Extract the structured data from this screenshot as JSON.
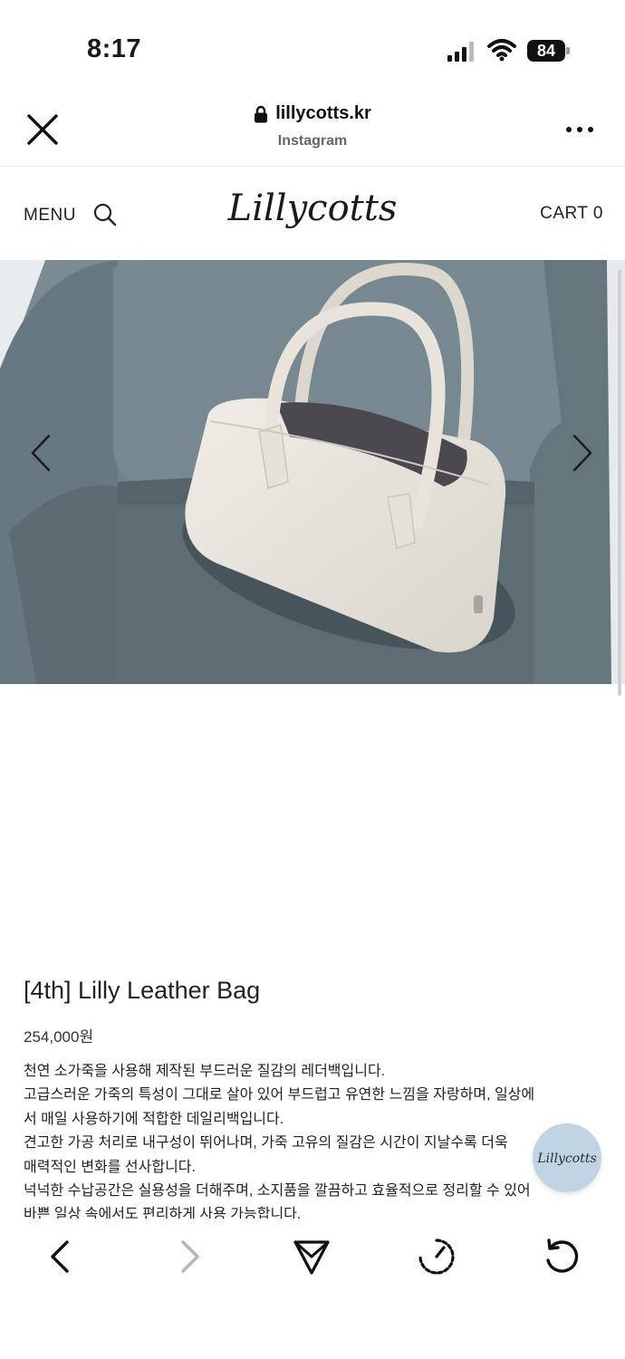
{
  "status_bar": {
    "time": "8:17",
    "battery": "84"
  },
  "browser": {
    "url": "lillycotts.kr",
    "source": "Instagram"
  },
  "site_header": {
    "menu_label": "MENU",
    "logo_text": "Lillycotts",
    "cart_label": "CART 0"
  },
  "product": {
    "title": "[4th] Lilly Leather Bag",
    "price": "254,000원",
    "description": [
      "천연 소가죽을 사용해 제작된 부드러운 질감의 레더백입니다.",
      "고급스러운 가죽의 특성이 그대로 살아 있어 부드럽고 유연한 느낌을 자랑하며, 일상에",
      "서 매일 사용하기에 적합한 데일리백입니다.",
      "견고한 가공 처리로 내구성이 뛰어나며, 가죽 고유의 질감은 시간이 지날수록 더욱",
      "매력적인 변화를 선사합니다.",
      "넉넉한 수납공간은 실용성을 더해주며, 소지품을 깔끔하고 효율적으로 정리할 수 있어",
      "바쁜 일상 속에서도 편리하게 사용 가능합니다."
    ]
  },
  "floating_badge": {
    "text": "Lillycotts"
  },
  "icons": {
    "close": "close-icon",
    "lock": "lock-icon",
    "more": "more-icon",
    "search": "search-icon",
    "prev": "chevron-left-icon",
    "next": "chevron-right-icon",
    "back": "back-icon",
    "forward": "forward-icon",
    "share": "send-icon",
    "history": "history-icon",
    "reload": "reload-icon"
  },
  "colors": {
    "sofa": "#6f7f86",
    "bag": "#e8e5de",
    "badge": "#bed2e2",
    "text": "#222222"
  }
}
